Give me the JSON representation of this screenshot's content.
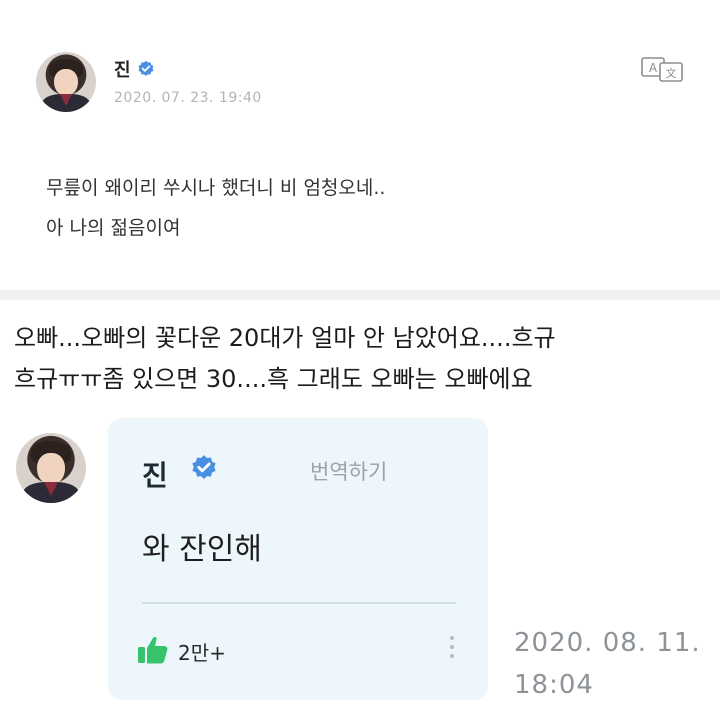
{
  "post": {
    "author": "진",
    "date": "2020. 07. 23. 19:40",
    "lines": [
      "무릎이 왜이리 쑤시나 했더니 비 엄청오네..",
      "아 나의 젊음이여"
    ]
  },
  "caption": {
    "lines": [
      "오빠...오빠의 꽃다운 20대가 얼마 안 남았어요....흐규",
      "흐규ㅠㅠ좀 있으면 30....흑 그래도 오빠는 오빠에요"
    ]
  },
  "reply": {
    "author": "진",
    "translate_label": "번역하기",
    "text": "와 잔인해",
    "likes": "2만+",
    "date_line1": "2020. 08. 11.",
    "date_line2": "18:04"
  },
  "colors": {
    "verified_badge": "#4a90e2",
    "like_icon": "#37c36c",
    "reply_card_bg": "#edf6fa"
  },
  "icons": [
    "verified-badge-icon",
    "translate-icon",
    "thumbs-up-icon",
    "more-vertical-icon"
  ]
}
